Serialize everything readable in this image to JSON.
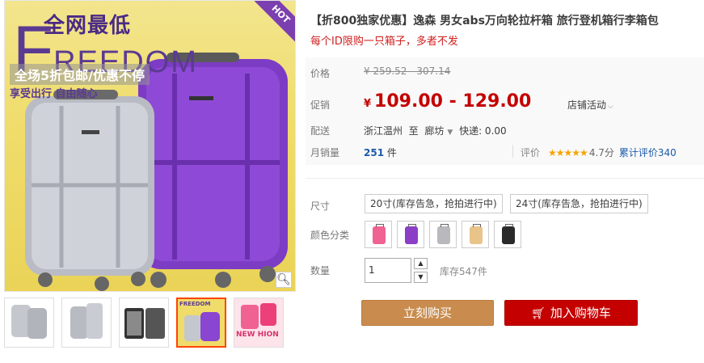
{
  "gallery": {
    "promo_title": "全网最低",
    "brand_big": "F",
    "brand_rest": "REEDOM",
    "promo_line": "全场5折包邮/优惠不停",
    "promo_sub": "享受出行 自由随心",
    "hot_badge": "HOT",
    "zoom_icon": "magnifier-icon",
    "thumbnails": [
      {
        "label": "",
        "active": false
      },
      {
        "label": "",
        "active": false
      },
      {
        "label": "",
        "active": false
      },
      {
        "label": "FREEDOM",
        "active": true
      },
      {
        "label": "NEW HION",
        "active": false
      }
    ]
  },
  "product": {
    "title": "【折800独家优惠】逸森 男女abs万向轮拉杆箱 旅行登机箱行李箱包",
    "subtitle": "每个ID限购一只箱子，多者不发",
    "price": {
      "label": "价格",
      "original": "¥ 259.52 - 307.14"
    },
    "promo": {
      "label": "促销",
      "currency": "¥",
      "amount": "109.00 - 129.00",
      "activity": "店铺活动"
    },
    "shipping": {
      "label": "配送",
      "from": "浙江温州",
      "to_word": "至",
      "dest": "廊坊",
      "express": "快递: 0.00"
    },
    "sales": {
      "label": "月销量",
      "count": "251",
      "unit": "件"
    },
    "rating": {
      "label": "评价",
      "stars": "★★★★★",
      "score": "4.7分",
      "total": "累计评价340"
    }
  },
  "options": {
    "size_label": "尺寸",
    "sizes": [
      "20寸(库存告急，抢拍进行中)",
      "24寸(库存告急，抢拍进行中)"
    ],
    "color_label": "颜色分类",
    "colors": [
      "#f06292",
      "#8b3fc6",
      "#b8b8bd",
      "#e9c48a",
      "#2a2a2a"
    ],
    "qty_label": "数量",
    "qty_value": "1",
    "stock": "库存547件"
  },
  "actions": {
    "buy_now": "立刻购买",
    "add_to_cart": "加入购物车",
    "cart_icon": "cart-icon"
  }
}
